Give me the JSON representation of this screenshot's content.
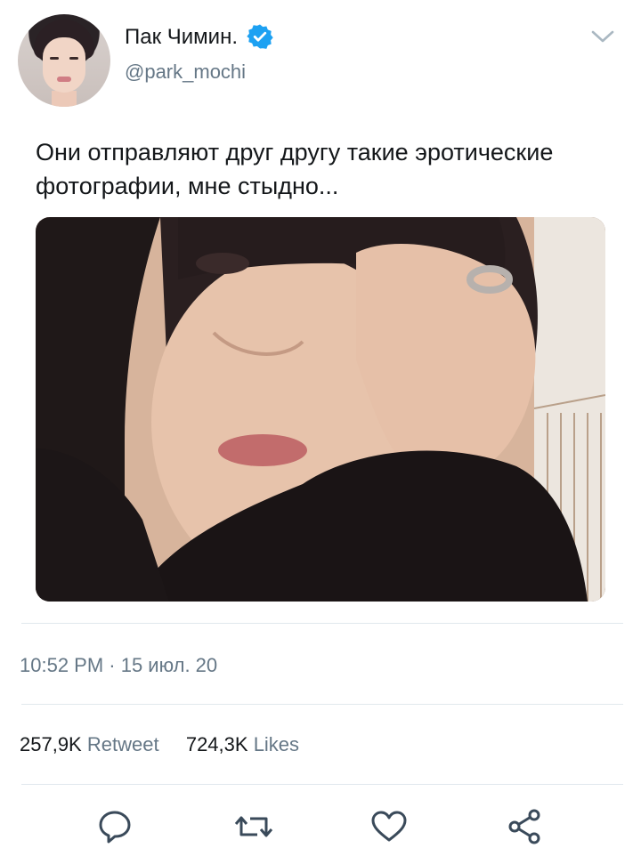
{
  "user": {
    "display_name": "Пак Чимин.",
    "handle": "@park_mochi",
    "verified": true
  },
  "tweet": {
    "text": "Они отправляют друг другу такие эротические фотографии, мне стыдно...",
    "timestamp": "10:52 PM · 15 июл. 20"
  },
  "stats": {
    "retweets_count": "257,9K",
    "retweets_label": "Retweet",
    "likes_count": "724,3K",
    "likes_label": "Likes"
  },
  "icons": {
    "more": "chevron-down-icon",
    "reply": "reply-icon",
    "retweet": "retweet-icon",
    "like": "heart-icon",
    "share": "share-icon",
    "verified": "verified-badge-icon"
  },
  "colors": {
    "accent": "#1da1f2",
    "secondary_text": "#657786",
    "primary_text": "#14171a",
    "divider": "#e1e8ed"
  }
}
